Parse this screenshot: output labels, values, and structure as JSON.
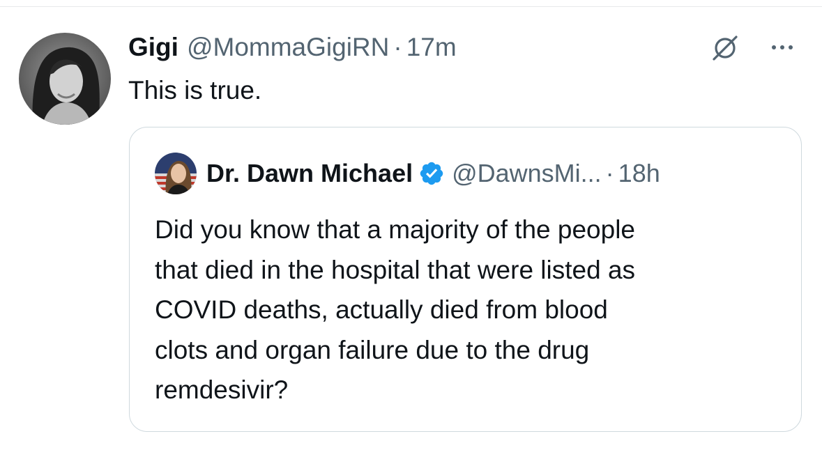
{
  "tweet": {
    "display_name": "Gigi",
    "handle": "@MommaGigiRN",
    "separator": "·",
    "timestamp": "17m",
    "text": "This is true.",
    "avatar_icon": "user-avatar-photo",
    "grok_icon": "slash-circle-icon",
    "more_icon": "more-dots-icon"
  },
  "quoted_tweet": {
    "display_name": "Dr. Dawn Michael",
    "verified": true,
    "verified_color": "#1d9bf0",
    "handle": "@DawnsMi...",
    "separator": "·",
    "timestamp": "18h",
    "text_lines": [
      "Did you know that a majority of the people",
      "that died in the hospital that were listed as",
      "COVID deaths, actually died from blood",
      "clots and organ failure due to the drug",
      "remdesivir?"
    ]
  },
  "colors": {
    "text_primary": "#0f1419",
    "text_secondary": "#536471",
    "border": "#cfd9de",
    "accent": "#1d9bf0"
  }
}
